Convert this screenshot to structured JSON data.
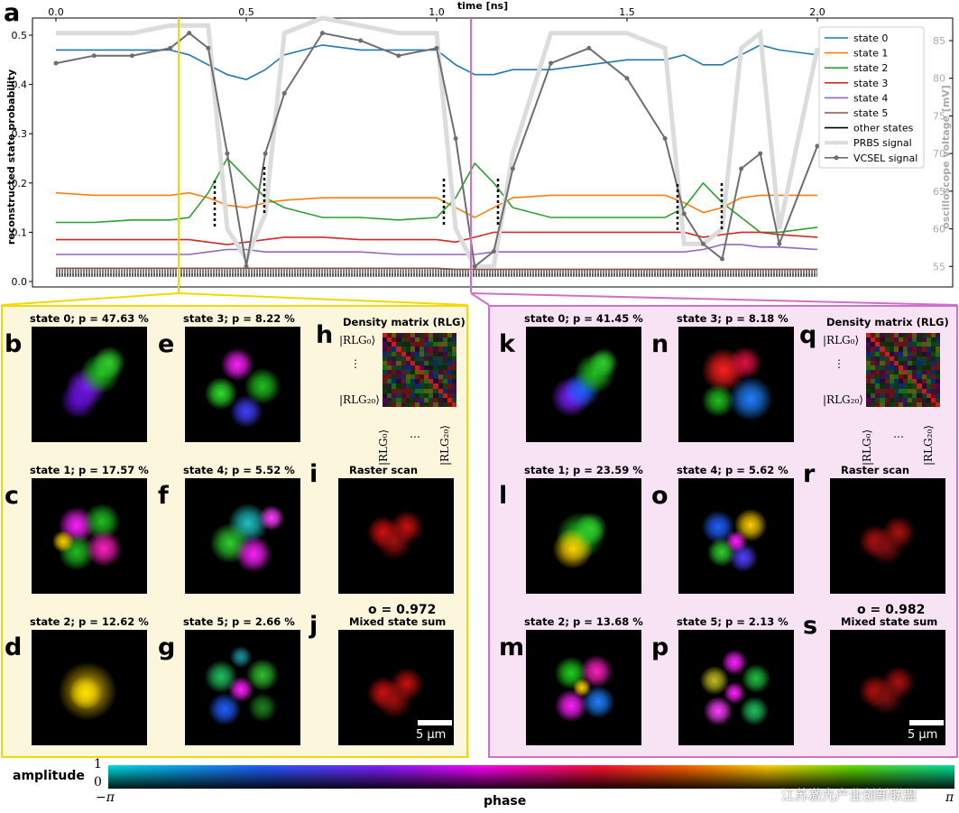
{
  "panel_a": {
    "letter": "a",
    "top_axis_label": "time [ns]",
    "top_ticks": [
      "0.0",
      "0.5",
      "1.0",
      "1.5",
      "2.0"
    ],
    "ylabel_left": "reconstructed state probability",
    "left_ticks": [
      "0.0",
      "0.1",
      "0.2",
      "0.3",
      "0.4",
      "0.5"
    ],
    "ylabel_right": "oscilloscope voltage [mV]",
    "right_ticks": [
      "55",
      "60",
      "65",
      "70",
      "75",
      "80",
      "85"
    ],
    "legend": [
      "state 0",
      "state 1",
      "state 2",
      "state 3",
      "state 4",
      "state 5",
      "other states",
      "PRBS signal",
      "VCSEL signal"
    ],
    "colors": {
      "state0": "#1f77b4",
      "state1": "#ff7f0e",
      "state2": "#2ca02c",
      "state3": "#d62728",
      "state4": "#9467bd",
      "state5": "#8c564b",
      "other": "#000000",
      "prbs": "#dcdcdc",
      "vcsel": "#6e6e6e",
      "marker_left": "#f5d800",
      "marker_right": "#d070c8"
    }
  },
  "chart_data": {
    "type": "line",
    "xlabel": "time [ns]",
    "ylabel": "reconstructed state probability",
    "y2label": "oscilloscope voltage [mV]",
    "xlim": [
      0.0,
      2.0
    ],
    "ylim": [
      0.0,
      0.52
    ],
    "y2lim": [
      53,
      88
    ],
    "x": [
      0.0,
      0.1,
      0.2,
      0.3,
      0.35,
      0.4,
      0.45,
      0.5,
      0.55,
      0.6,
      0.7,
      0.8,
      0.9,
      1.0,
      1.05,
      1.1,
      1.15,
      1.2,
      1.3,
      1.4,
      1.5,
      1.6,
      1.65,
      1.7,
      1.75,
      1.8,
      1.85,
      1.9,
      2.0
    ],
    "series": [
      {
        "name": "state 0",
        "values": [
          0.47,
          0.47,
          0.47,
          0.47,
          0.46,
          0.44,
          0.42,
          0.41,
          0.43,
          0.46,
          0.48,
          0.47,
          0.47,
          0.47,
          0.44,
          0.42,
          0.42,
          0.43,
          0.43,
          0.44,
          0.45,
          0.45,
          0.46,
          0.44,
          0.44,
          0.46,
          0.48,
          0.47,
          0.46
        ]
      },
      {
        "name": "state 1",
        "values": [
          0.18,
          0.175,
          0.175,
          0.175,
          0.18,
          0.17,
          0.155,
          0.15,
          0.16,
          0.165,
          0.17,
          0.17,
          0.17,
          0.17,
          0.15,
          0.13,
          0.15,
          0.17,
          0.175,
          0.175,
          0.175,
          0.175,
          0.16,
          0.14,
          0.15,
          0.17,
          0.175,
          0.175,
          0.175
        ]
      },
      {
        "name": "state 2",
        "values": [
          0.12,
          0.12,
          0.125,
          0.125,
          0.13,
          0.18,
          0.25,
          0.21,
          0.17,
          0.15,
          0.13,
          0.13,
          0.125,
          0.13,
          0.17,
          0.24,
          0.2,
          0.15,
          0.13,
          0.13,
          0.13,
          0.13,
          0.15,
          0.2,
          0.16,
          0.13,
          0.1,
          0.1,
          0.11
        ]
      },
      {
        "name": "state 3",
        "values": [
          0.085,
          0.085,
          0.085,
          0.085,
          0.085,
          0.08,
          0.075,
          0.08,
          0.085,
          0.09,
          0.09,
          0.085,
          0.085,
          0.085,
          0.08,
          0.09,
          0.1,
          0.1,
          0.1,
          0.1,
          0.1,
          0.1,
          0.1,
          0.09,
          0.095,
          0.1,
          0.1,
          0.095,
          0.09
        ]
      },
      {
        "name": "state 4",
        "values": [
          0.055,
          0.055,
          0.055,
          0.055,
          0.055,
          0.06,
          0.065,
          0.065,
          0.06,
          0.06,
          0.06,
          0.06,
          0.055,
          0.055,
          0.055,
          0.055,
          0.06,
          0.06,
          0.06,
          0.06,
          0.06,
          0.06,
          0.06,
          0.065,
          0.075,
          0.075,
          0.07,
          0.07,
          0.065
        ]
      },
      {
        "name": "state 5",
        "values": [
          0.027,
          0.027,
          0.027,
          0.027,
          0.027,
          0.027,
          0.027,
          0.027,
          0.027,
          0.027,
          0.027,
          0.027,
          0.027,
          0.027,
          0.025,
          0.025,
          0.025,
          0.025,
          0.025,
          0.025,
          0.025,
          0.025,
          0.025,
          0.025,
          0.025,
          0.025,
          0.025,
          0.025,
          0.025
        ]
      },
      {
        "name": "other states",
        "values": [
          0.01,
          0.01,
          0.01,
          0.01,
          0.01,
          0.01,
          0.01,
          0.01,
          0.01,
          0.01,
          0.01,
          0.01,
          0.01,
          0.01,
          0.01,
          0.01,
          0.01,
          0.01,
          0.01,
          0.01,
          0.01,
          0.01,
          0.01,
          0.01,
          0.01,
          0.01,
          0.01,
          0.01,
          0.01
        ]
      }
    ],
    "series_y2": [
      {
        "name": "PRBS signal",
        "values": [
          86,
          86,
          86,
          87,
          87,
          87,
          60,
          56,
          62,
          86,
          88,
          87,
          86,
          86,
          60,
          55,
          55,
          70,
          86,
          86,
          86,
          84,
          58,
          58,
          60,
          84,
          86,
          60,
          84
        ]
      },
      {
        "name": "VCSEL signal",
        "values": [
          82,
          83,
          83,
          84,
          86,
          84,
          70,
          55,
          70,
          78,
          86,
          85,
          83,
          84,
          72,
          55,
          57,
          68,
          82,
          84,
          80,
          72,
          62,
          58,
          56,
          68,
          70,
          58,
          71
        ]
      }
    ]
  },
  "left_group": {
    "modes": [
      {
        "letter": "b",
        "title": "state 0; p = 47.63 %"
      },
      {
        "letter": "c",
        "title": "state 1; p = 17.57 %"
      },
      {
        "letter": "d",
        "title": "state 2; p = 12.62 %"
      },
      {
        "letter": "e",
        "title": "state 3; p = 8.22 %"
      },
      {
        "letter": "f",
        "title": "state 4; p = 5.52 %"
      },
      {
        "letter": "g",
        "title": "state 5; p = 2.66 %"
      }
    ],
    "density": {
      "letter": "h",
      "title": "Density matrix (RLG)",
      "ket_top": "|RLG₀⟩",
      "ket_dots": "⋮",
      "ket_bottom": "|RLG₂₀⟩",
      "bra_left": "|RLG₀⟩",
      "bra_dots": "…",
      "bra_right": "|RLG₂₀⟩"
    },
    "raster": {
      "letter": "i",
      "title": "Raster scan"
    },
    "overlap": "o = 0.972",
    "mixed": {
      "letter": "j",
      "title": "Mixed state sum"
    },
    "scale": "5 μm"
  },
  "right_group": {
    "modes": [
      {
        "letter": "k",
        "title": "state 0; p = 41.45 %"
      },
      {
        "letter": "l",
        "title": "state 1; p = 23.59 %"
      },
      {
        "letter": "m",
        "title": "state 2; p = 13.68 %"
      },
      {
        "letter": "n",
        "title": "state 3; p = 8.18 %"
      },
      {
        "letter": "o",
        "title": "state 4; p = 5.62 %"
      },
      {
        "letter": "p",
        "title": "state 5; p = 2.13 %"
      }
    ],
    "density": {
      "letter": "q",
      "title": "Density matrix (RLG)",
      "ket_top": "|RLG₀⟩",
      "ket_dots": "⋮",
      "ket_bottom": "|RLG₂₀⟩",
      "bra_left": "|RLG₀⟩",
      "bra_dots": "…",
      "bra_right": "|RLG₂₀⟩"
    },
    "raster": {
      "letter": "r",
      "title": "Raster scan"
    },
    "overlap": "o = 0.982",
    "mixed": {
      "letter": "s",
      "title": "Mixed state sum"
    },
    "scale": "5 μm"
  },
  "colorbar": {
    "amplitude_label": "amplitude",
    "amp_top": "1",
    "amp_bottom": "0",
    "phase_left": "−π",
    "phase_right": "π",
    "phase_label": "phase"
  },
  "watermark": "江苏激光产业创新联盟"
}
